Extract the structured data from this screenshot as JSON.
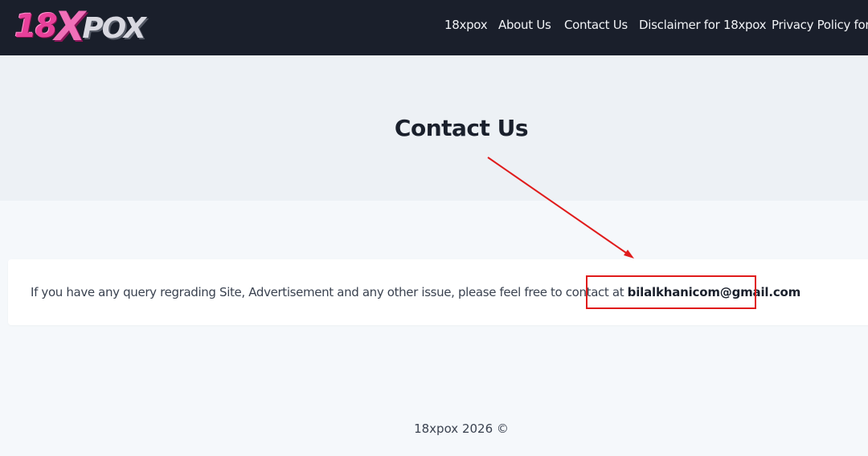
{
  "logo": {
    "num": "18",
    "x": "X",
    "pox": "POX"
  },
  "nav": {
    "items": [
      {
        "label": "18xpox"
      },
      {
        "label": "About Us"
      },
      {
        "label": "Contact Us"
      },
      {
        "label": "Disclaimer for 18xpox"
      },
      {
        "label": "Privacy Policy for"
      }
    ]
  },
  "hero": {
    "title": "Contact Us"
  },
  "content": {
    "text": "If you have any query regrading Site, Advertisement and any other issue, please feel free to contact at ",
    "email": "bilalkhanicom@gmail.com"
  },
  "footer": {
    "text": "18xpox 2026 ©"
  },
  "annotation": {
    "color": "#e01b1b"
  },
  "colors": {
    "header_bg": "#1a1f2b",
    "hero_bg": "#edf1f5",
    "page_bg": "#f5f8fb",
    "brand_pink": "#e8409a"
  }
}
